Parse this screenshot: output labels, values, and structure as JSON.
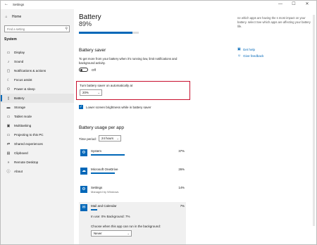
{
  "window": {
    "title": "Settings",
    "controls": [
      "—",
      "☐",
      "✕"
    ]
  },
  "sidebar": {
    "home": "Home",
    "search_placeholder": "Find a setting",
    "section": "System",
    "items": [
      {
        "label": "Display",
        "icon": "display-icon",
        "glyph": "▭",
        "active": false
      },
      {
        "label": "Sound",
        "icon": "sound-icon",
        "glyph": "♪",
        "active": false
      },
      {
        "label": "Notifications & actions",
        "icon": "notifications-icon",
        "glyph": "▢",
        "active": false
      },
      {
        "label": "Focus assist",
        "icon": "focus-assist-icon",
        "glyph": "☾",
        "active": false
      },
      {
        "label": "Power & sleep",
        "icon": "power-icon",
        "glyph": "⏻",
        "active": false
      },
      {
        "label": "Battery",
        "icon": "battery-icon",
        "glyph": "▯",
        "active": true
      },
      {
        "label": "Storage",
        "icon": "storage-icon",
        "glyph": "▬",
        "active": false
      },
      {
        "label": "Tablet mode",
        "icon": "tablet-icon",
        "glyph": "▭",
        "active": false
      },
      {
        "label": "Multitasking",
        "icon": "multitasking-icon",
        "glyph": "▣",
        "active": false
      },
      {
        "label": "Projecting to this PC",
        "icon": "project-icon",
        "glyph": "▭",
        "active": false
      },
      {
        "label": "Shared experiences",
        "icon": "shared-icon",
        "glyph": "⇄",
        "active": false
      },
      {
        "label": "Clipboard",
        "icon": "clipboard-icon",
        "glyph": "▤",
        "active": false
      },
      {
        "label": "Remote Desktop",
        "icon": "remote-desktop-icon",
        "glyph": "»",
        "active": false
      },
      {
        "label": "About",
        "icon": "about-icon",
        "glyph": "ⓘ",
        "active": false
      }
    ]
  },
  "main": {
    "title": "Battery",
    "percentage": "89%",
    "percentage_value": 0.89,
    "saver_heading": "Battery saver",
    "saver_desc": "To get more from your battery when it's running low, limit notifications and background activity.",
    "toggle_state": "Off",
    "auto_label": "Turn battery saver on automatically at",
    "auto_value": "20%",
    "brightness_label": "Lower screen brightness while in battery saver",
    "usage_heading": "Battery usage per app",
    "time_period_label": "Time period:",
    "time_period_value": "24 hours",
    "apps": [
      {
        "name": "System",
        "sub": "",
        "pct": "37%",
        "value": 0.37
      },
      {
        "name": "Microsoft OneDrive",
        "sub": "",
        "pct": "26%",
        "value": 0.26
      },
      {
        "name": "Settings",
        "sub": "Managed by Windows",
        "pct": "14%",
        "value": 0.14
      },
      {
        "name": "Mail and Calendar",
        "sub": "",
        "pct": "7%",
        "value": 0.07
      }
    ],
    "expanded": {
      "usage": "In use: 0% Background: 7%",
      "question": "Choose when this app can run in the background:",
      "select_value": "Never"
    }
  },
  "right": {
    "hint": "ne which apps are having the s most impact on your battery. select See which apps are affecting your battery life.",
    "help": "Get help",
    "feedback": "Give feedback"
  }
}
